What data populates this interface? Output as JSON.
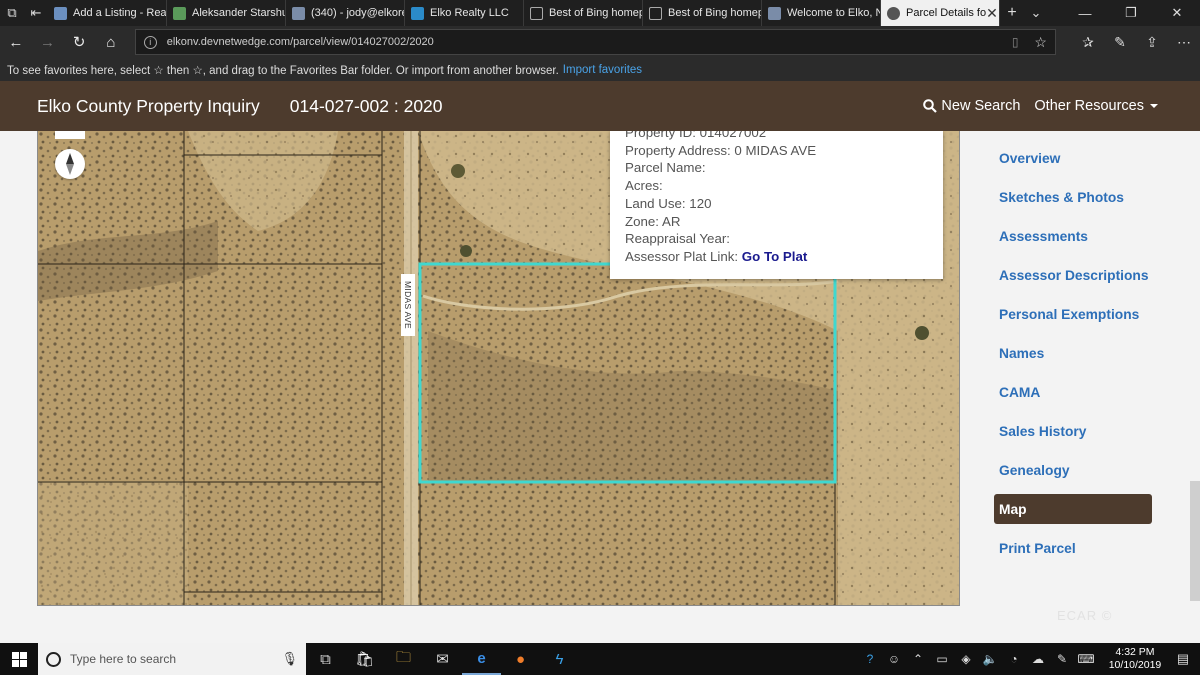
{
  "browser": {
    "tabs": [
      {
        "label": "Add a Listing - Real",
        "color": "#6b8fbf"
      },
      {
        "label": "Aleksander Starshu",
        "color": "#5a9a5a"
      },
      {
        "label": "(340) - jody@elkore",
        "color": "#7a8ca8"
      },
      {
        "label": "Elko Realty LLC",
        "color": "#2b8bc9"
      },
      {
        "label": "Best of Bing homep",
        "color": "#888888"
      },
      {
        "label": "Best of Bing homep",
        "color": "#888888"
      },
      {
        "label": "Welcome to Elko, N",
        "color": "#7a8ca8"
      },
      {
        "label": "Parcel Details fo",
        "color": "#555555",
        "active": true
      }
    ],
    "url": "elkonv.devnetwedge.com/parcel/view/014027002/2020"
  },
  "favorites_hint": {
    "text": "To see favorites here, select ☆ then ☆, and drag to the Favorites Bar folder. Or import from another browser.",
    "link": "Import favorites"
  },
  "header": {
    "title": "Elko County Property Inquiry",
    "parcel": "014-027-002 : 2020",
    "new_search": "New Search",
    "other_resources": "Other Resources"
  },
  "map": {
    "street_label": "MIDAS AVE",
    "popup": {
      "property_id": "Property ID: 014027002",
      "address": "Property Address: 0 MIDAS AVE",
      "parcel_name": "Parcel Name:",
      "acres": "Acres:",
      "land_use": "Land Use: 120",
      "zone": "Zone: AR",
      "reappraisal": "Reappraisal Year:",
      "plat_label": "Assessor Plat Link:",
      "plat_link": "Go To Plat"
    },
    "colors": {
      "parcel_outline": "#3fd8d0",
      "terrain": "#c2a777"
    }
  },
  "sidebar": {
    "items": [
      {
        "label": "Overview"
      },
      {
        "label": "Sketches & Photos"
      },
      {
        "label": "Assessments"
      },
      {
        "label": "Assessor Descriptions"
      },
      {
        "label": "Personal Exemptions"
      },
      {
        "label": "Names"
      },
      {
        "label": "CAMA"
      },
      {
        "label": "Sales History"
      },
      {
        "label": "Genealogy"
      },
      {
        "label": "Map",
        "active": true
      },
      {
        "label": "Print Parcel"
      }
    ]
  },
  "watermark": "ECAR ©",
  "taskbar": {
    "search_placeholder": "Type here to search",
    "time": "4:32 PM",
    "date": "10/10/2019"
  }
}
